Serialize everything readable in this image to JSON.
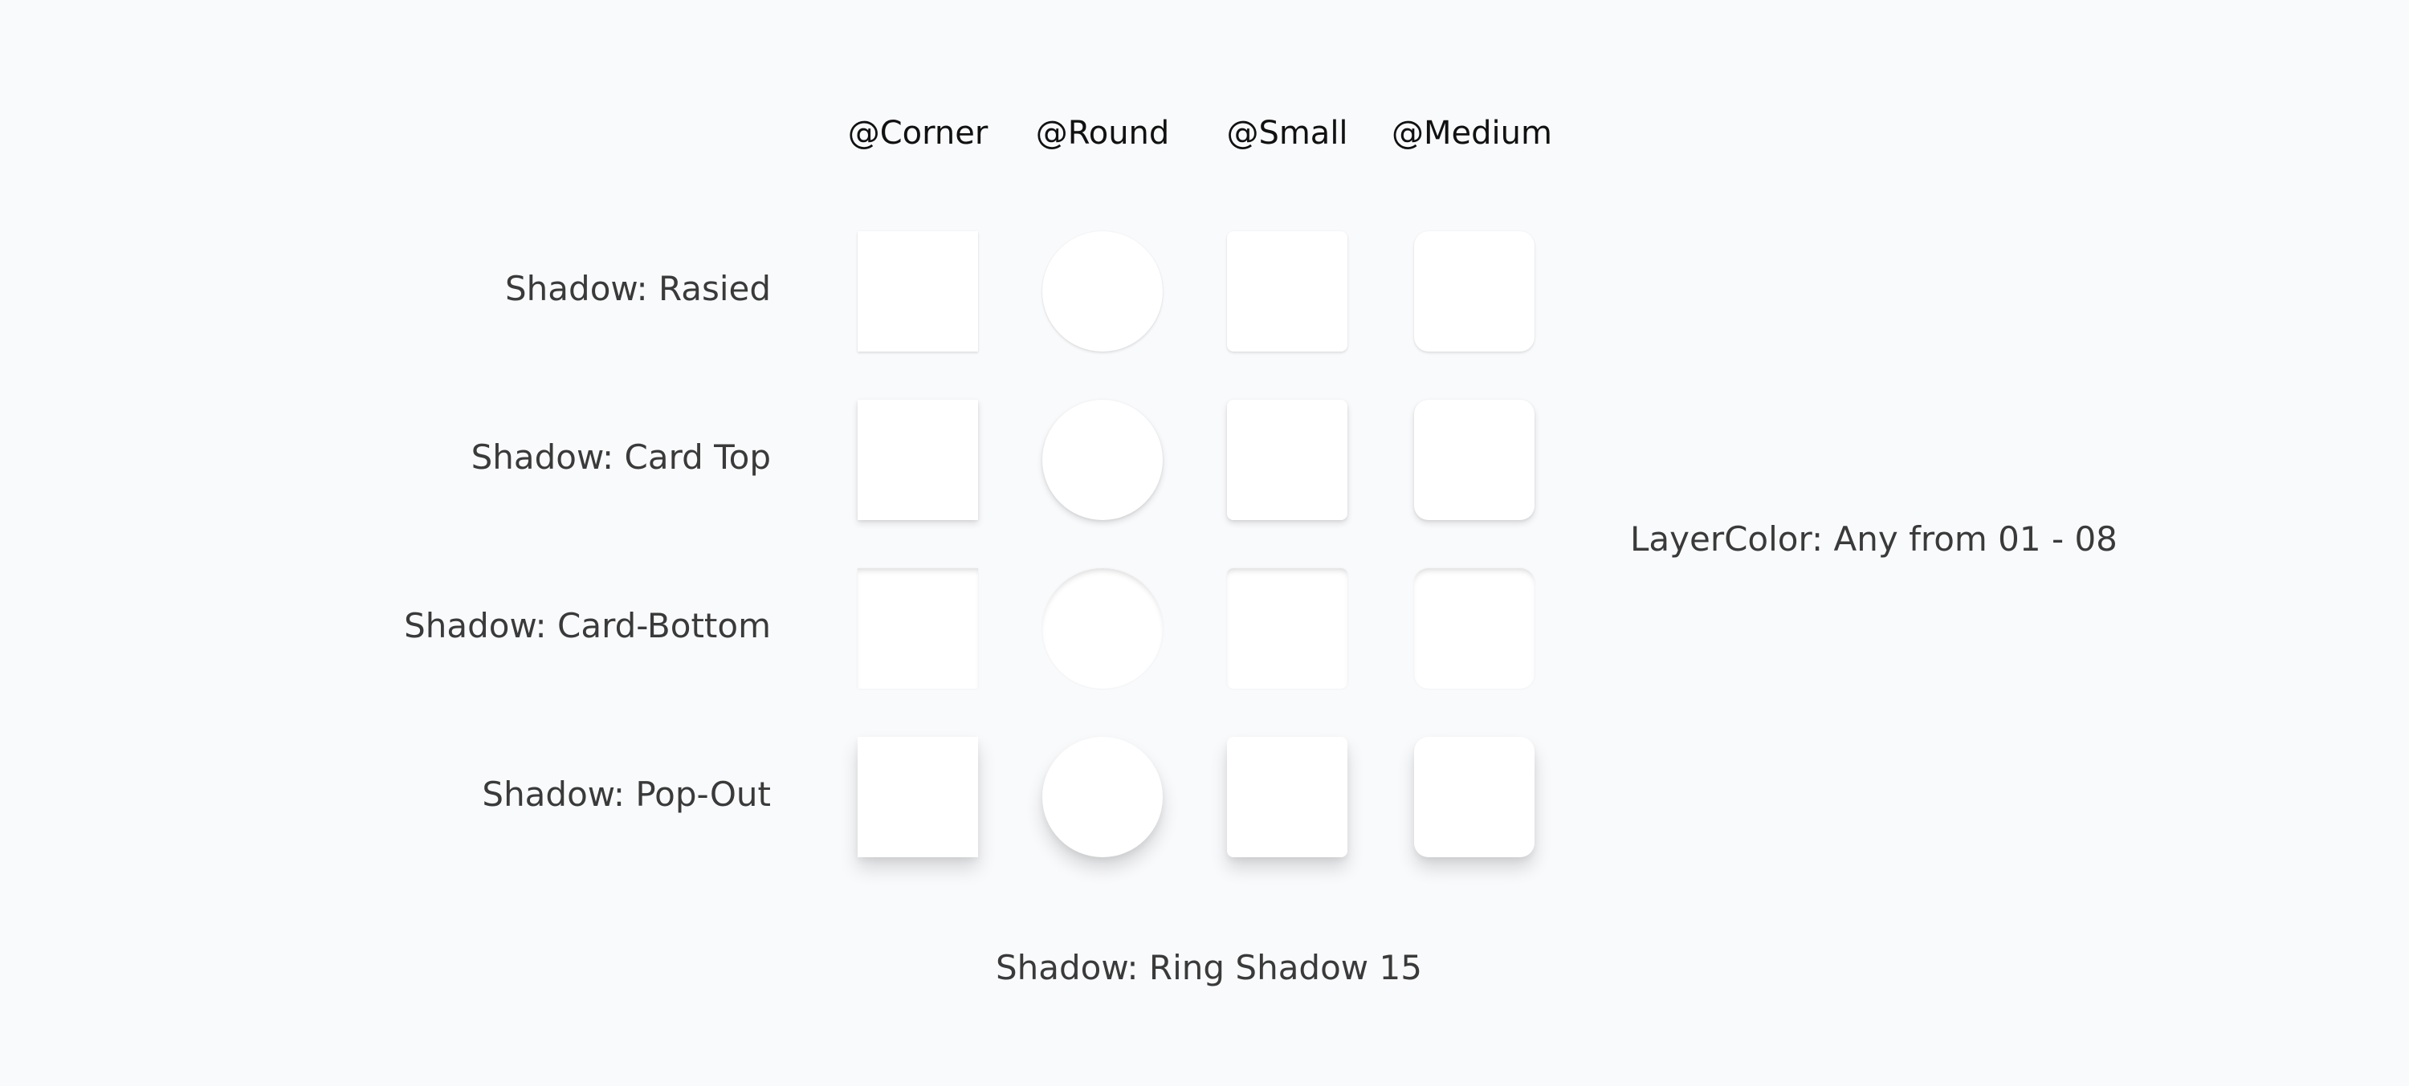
{
  "columns": {
    "corner": "@Corner",
    "round": "@Round",
    "small": "@Small",
    "medium": "@Medium"
  },
  "rows": {
    "raised": "Shadow: Rasied",
    "card_top": "Shadow: Card Top",
    "card_bottom": "Shadow: Card-Bottom",
    "pop_out": "Shadow: Pop-Out"
  },
  "side_label": "LayerColor: Any from 01 - 08",
  "footer_label": "Shadow: Ring Shadow 15",
  "colors": {
    "background": "#f9fafc",
    "tile": "#ffffff",
    "label": "#3a3a3a",
    "header": "#111111"
  }
}
